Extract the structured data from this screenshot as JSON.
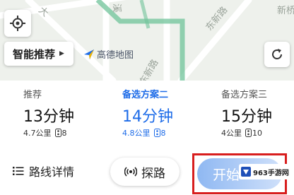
{
  "map": {
    "street_labels": [
      "大",
      "溪",
      "东新路",
      "新桥",
      "东新路"
    ],
    "logo_text": "高德地图"
  },
  "controls": {
    "locate_icon": "crosshair-icon",
    "smart_recommend_label": "智能推荐",
    "refresh_icon": "refresh-icon"
  },
  "routes": [
    {
      "name": "推荐",
      "time": "13分钟",
      "distance": "4.7公里",
      "lights": "8",
      "active": false
    },
    {
      "name": "备选方案二",
      "time": "14分钟",
      "distance": "4.8公里",
      "lights": "8",
      "active": true
    },
    {
      "name": "备选方案三",
      "time": "15分钟",
      "distance": "4公里",
      "lights": "10",
      "active": false
    }
  ],
  "bottom": {
    "detail_label": "路线详情",
    "explore_label": "探路",
    "start_label": "开始"
  },
  "watermark": {
    "text": "963手游网"
  },
  "colors": {
    "accent": "#1e6ce8",
    "highlight_border": "#d81e1e",
    "route_green": "#4caf7a"
  }
}
